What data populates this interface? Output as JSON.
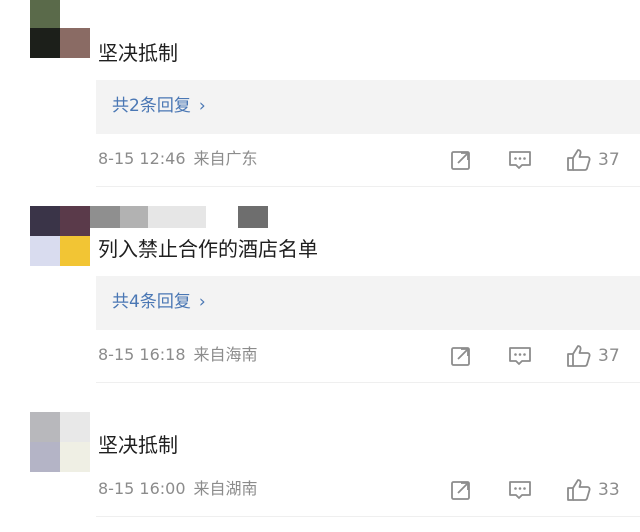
{
  "comments": [
    {
      "text": "坚决抵制",
      "reply_label": "共2条回复",
      "date": "8-15 12:46",
      "location": "来自广东",
      "likes": "37"
    },
    {
      "text": "列入禁止合作的酒店名单",
      "reply_label": "共4条回复",
      "date": "8-15 16:18",
      "location": "来自海南",
      "likes": "37"
    },
    {
      "text": "坚决抵制",
      "date": "8-15 16:00",
      "location": "来自湖南",
      "likes": "33"
    }
  ],
  "icons": {
    "share": "share-icon",
    "comment": "comment-icon",
    "like": "thumbs-up-icon",
    "chevron": "chevron-right-icon"
  },
  "colors": {
    "link": "#4a77b4",
    "meta": "#8c8c8c",
    "reply_bg": "#f3f3f3"
  }
}
